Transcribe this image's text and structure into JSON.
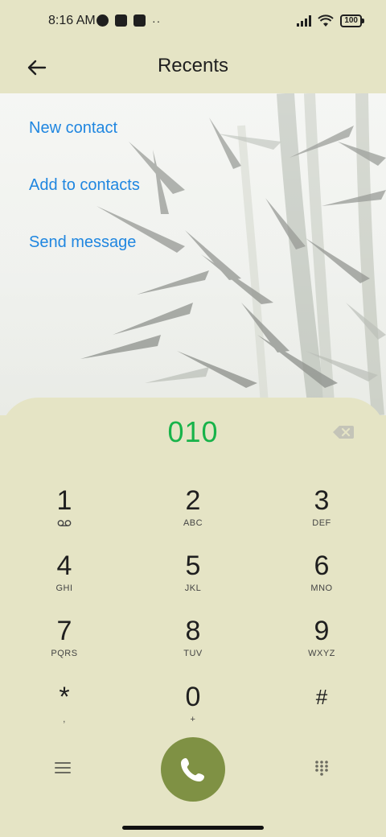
{
  "status_bar": {
    "time": "8:16 AM",
    "battery": "100",
    "overflow_dots": "··"
  },
  "header": {
    "title": "Recents",
    "back_icon": "arrow-left-icon"
  },
  "actions": [
    {
      "label": "New contact"
    },
    {
      "label": "Add to contacts"
    },
    {
      "label": "Send message"
    }
  ],
  "dialer": {
    "entered_number": "010",
    "keys": [
      {
        "digit": "1",
        "letters": ""
      },
      {
        "digit": "2",
        "letters": "ABC"
      },
      {
        "digit": "3",
        "letters": "DEF"
      },
      {
        "digit": "4",
        "letters": "GHI"
      },
      {
        "digit": "5",
        "letters": "JKL"
      },
      {
        "digit": "6",
        "letters": "MNO"
      },
      {
        "digit": "7",
        "letters": "PQRS"
      },
      {
        "digit": "8",
        "letters": "TUV"
      },
      {
        "digit": "9",
        "letters": "WXYZ"
      },
      {
        "digit": "*",
        "letters": ","
      },
      {
        "digit": "0",
        "letters": "+"
      },
      {
        "digit": "#",
        "letters": ""
      }
    ]
  },
  "colors": {
    "accent_blue": "#1f86e0",
    "number_green": "#18b34a",
    "call_button": "#7f9144",
    "panel_bg": "#e5e4c5"
  }
}
